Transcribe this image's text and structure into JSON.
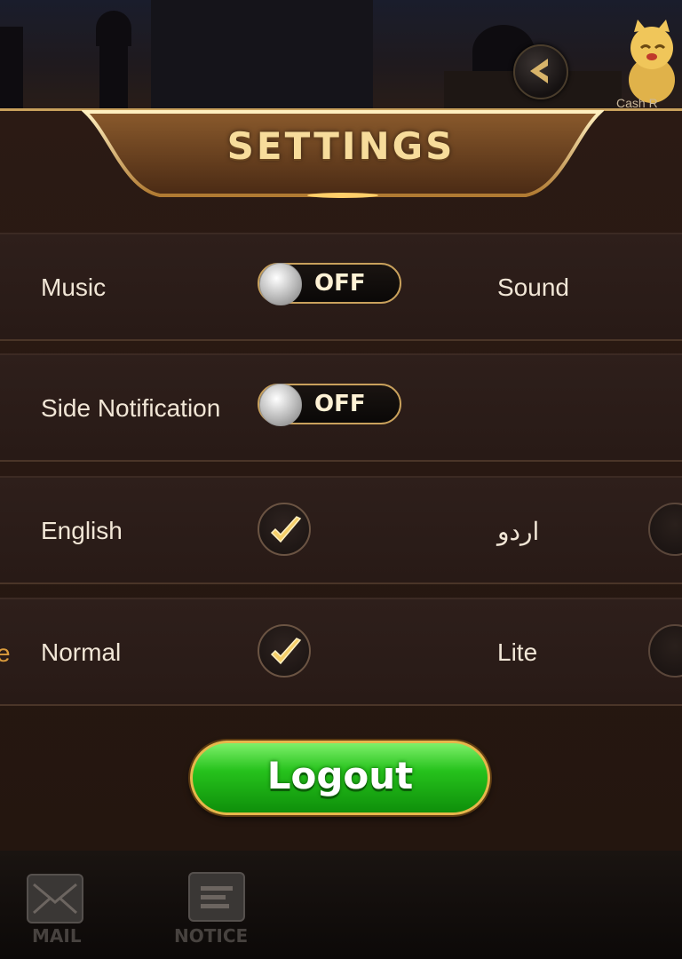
{
  "header": {
    "title": "SETTINGS",
    "back_icon": "chevron-left-icon",
    "mascot_icon": "lucky-cat-icon",
    "cash_label": "Cash R"
  },
  "settings": {
    "music": {
      "label": "Music",
      "state": "OFF"
    },
    "sound": {
      "label": "Sound"
    },
    "side_notification": {
      "label": "Side Notification",
      "state": "OFF"
    },
    "language": {
      "english": "English",
      "urdu": "اردو",
      "selected": "English"
    },
    "mode": {
      "normal": "Normal",
      "lite": "Lite",
      "selected": "Normal",
      "cut_label": "e"
    }
  },
  "logout_label": "Logout",
  "bottom_nav": [
    {
      "label": "MAIL",
      "icon": "mail-icon"
    },
    {
      "label": "NOTICE",
      "icon": "notice-icon"
    }
  ],
  "colors": {
    "gold": "#c9a15c",
    "green_button": "#26c21c",
    "panel": "#2b1a14"
  }
}
